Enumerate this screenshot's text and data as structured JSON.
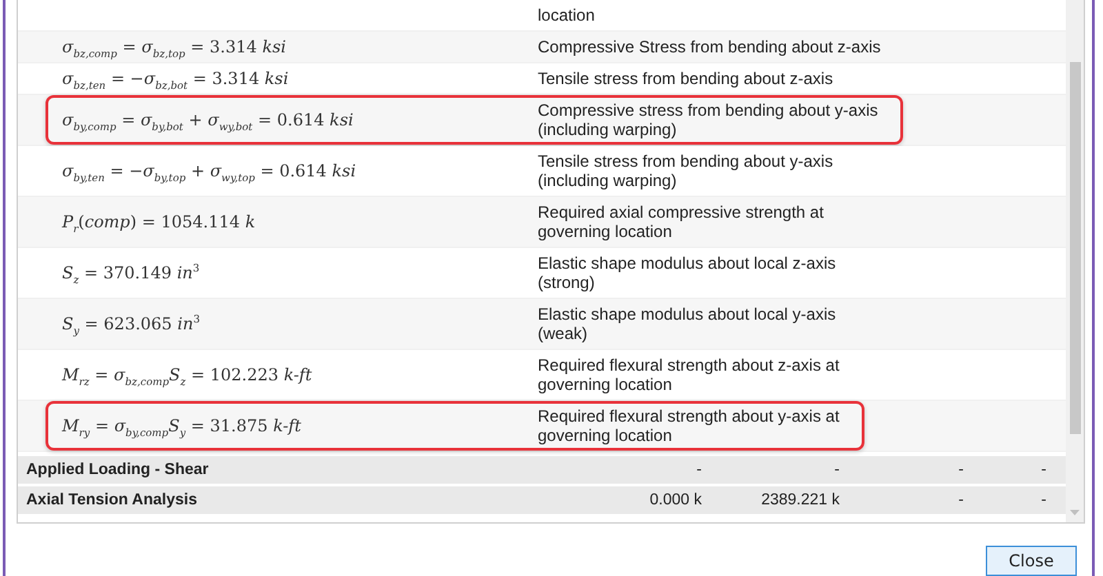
{
  "rows": [
    {
      "description": [
        "location"
      ],
      "highlighted": false
    },
    {
      "formula": "*σ*$_{bz,comp}$ = *σ*$_{bz,top}$ = 3.314 *ksi*",
      "description": [
        "Compressive Stress from bending about z-axis"
      ],
      "highlighted": false
    },
    {
      "formula": "*σ*$_{bz,ten}$ = −*σ*$_{bz,bot}$ = 3.314 *ksi*",
      "description": [
        "Tensile stress from bending about z-axis"
      ],
      "highlighted": false
    },
    {
      "formula": "*σ*$_{by,comp}$ = *σ*$_{by,bot}$ + *σ*$_{wy,bot}$ = 0.614 *ksi*",
      "description": [
        "Compressive stress from bending about y-axis",
        "(including warping)"
      ],
      "highlighted": true
    },
    {
      "formula": "*σ*$_{by,ten}$ = −*σ*$_{by,top}$ + *σ*$_{wy,top}$ = 0.614 *ksi*",
      "description": [
        "Tensile stress from bending about y-axis",
        "(including warping)"
      ],
      "highlighted": false
    },
    {
      "formula": "*P*$_{r}$(*comp*) = 1054.114 *k*",
      "description": [
        "Required axial compressive strength at",
        "governing location"
      ],
      "highlighted": false
    },
    {
      "formula": "*S*$_{z}$ = 370.149 *in*$^{3}$",
      "description": [
        "Elastic shape modulus about local z-axis",
        "(strong)"
      ],
      "highlighted": false
    },
    {
      "formula": "*S*$_{y}$ = 623.065 *in*$^{3}$",
      "description": [
        "Elastic shape modulus about local y-axis",
        "(weak)"
      ],
      "highlighted": false
    },
    {
      "formula": "*M*$_{rz}$ = *σ*$_{bz,comp}$*S*$_{z}$ = 102.223 *k-ft*",
      "description": [
        "Required flexural strength about z-axis at",
        "governing location"
      ],
      "highlighted": false
    },
    {
      "formula": "*M*$_{ry}$ = *σ*$_{by,comp}$*S*$_{y}$ = 31.875 *k-ft*",
      "description": [
        "Required flexural strength about y-axis at",
        "governing location"
      ],
      "highlighted": true
    }
  ],
  "sections": [
    {
      "label": "Applied Loading - Shear",
      "values": [
        "-",
        "-",
        "-",
        "-"
      ]
    },
    {
      "label": "Axial Tension Analysis",
      "values": [
        "0.000 k",
        "2389.221 k",
        "-",
        "-"
      ]
    }
  ],
  "close_button": "Close"
}
